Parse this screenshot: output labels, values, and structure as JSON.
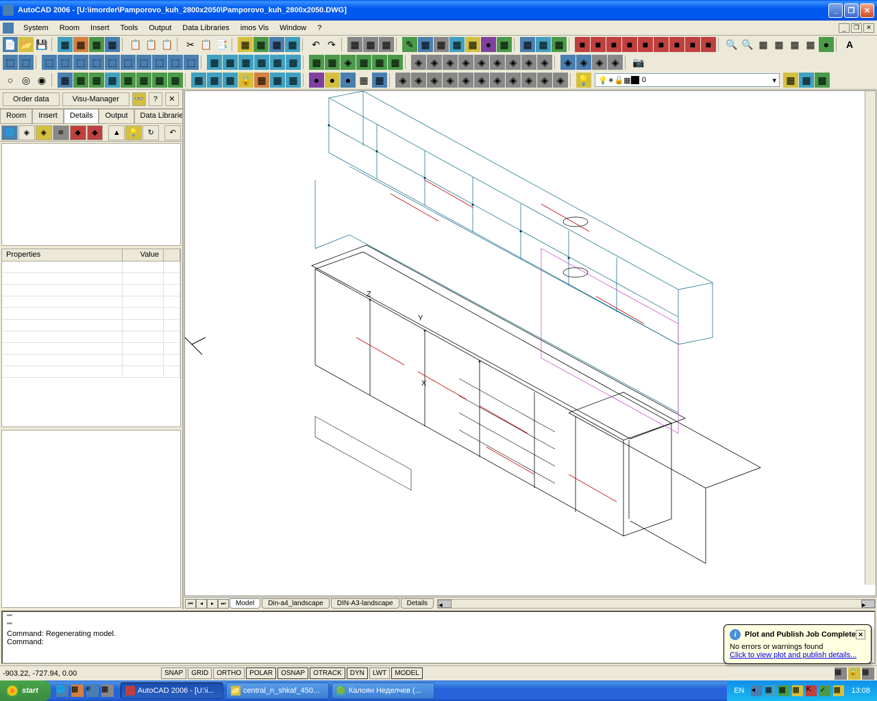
{
  "titlebar": {
    "app": "AutoCAD 2006",
    "doc": "[U:\\imorder\\Pamporovo_kuh_2800x2050\\Pamporovo_kuh_2800x2050.DWG]"
  },
  "menu": {
    "items": [
      "System",
      "Room",
      "Insert",
      "Tools",
      "Output",
      "Data Libraries",
      "imos Vis",
      "Window",
      "?"
    ]
  },
  "left_panel": {
    "order_btn": "Order data",
    "visu_btn": "Visu-Manager",
    "tabs": [
      "Room",
      "Insert",
      "Details",
      "Output",
      "Data Libraries"
    ],
    "active_tab": 2,
    "props_hdr": {
      "col1": "Properties",
      "col2": "Value"
    }
  },
  "layer": {
    "name": "0"
  },
  "model_tabs": {
    "items": [
      "Model",
      "Din-a4_landscape",
      "DIN-A3-landscape",
      "Details"
    ],
    "active": 0
  },
  "cmd": {
    "l1": "\"\"",
    "l2": "\"\"",
    "l3": "Command: Regenerating model.",
    "l4": "Command:"
  },
  "balloon": {
    "title": "Plot and Publish Job Complete",
    "msg": "No errors or warnings found",
    "link": "Click to view plot and publish details..."
  },
  "status": {
    "coords": "-903.22, -727.94, 0.00",
    "toggles": [
      "SNAP",
      "GRID",
      "ORTHO",
      "POLAR",
      "OSNAP",
      "OTRACK",
      "DYN",
      "LWT",
      "MODEL"
    ]
  },
  "taskbar": {
    "start": "start",
    "tasks": [
      {
        "label": "AutoCAD 2006 - [U:\\i...",
        "active": true
      },
      {
        "label": "central_n_shkaf_450...",
        "active": false
      },
      {
        "label": "Калоян Неделчев (...",
        "active": false
      }
    ],
    "lang": "EN",
    "time": "13:08"
  }
}
